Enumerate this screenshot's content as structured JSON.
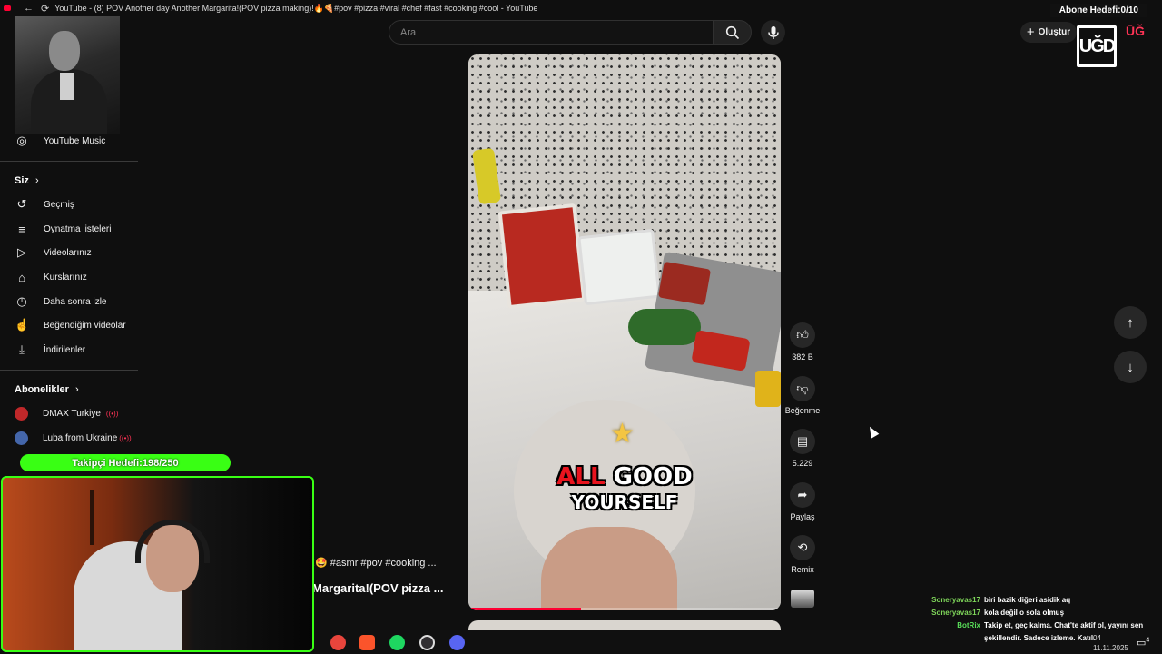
{
  "window": {
    "title": "YouTube - (8) POV Another day Another Margarita!(POV pizza making)!🔥🍕#pov #pizza #viral #chef #fast #cooking #cool - YouTube",
    "back_icon": "←",
    "reload_icon": "⟳"
  },
  "overlay": {
    "subscriber_goal": "Abone Hedefi:0/10",
    "follower_goal": "Takipçi Hedefi:198/250",
    "follower_progress": 0.792,
    "logo_text": "UĞD",
    "logo_small": "ŪĞ"
  },
  "header": {
    "search_placeholder": "Ara",
    "create_label": "Oluştur",
    "search_icon": "search-icon",
    "mic_icon": "mic-icon"
  },
  "sidebar": {
    "youtube_music": "YouTube Music",
    "you_heading": "Siz",
    "you_items": [
      {
        "label": "Geçmiş",
        "icon": "history-icon"
      },
      {
        "label": "Oynatma listeleri",
        "icon": "playlist-icon"
      },
      {
        "label": "Videolarınız",
        "icon": "your-videos-icon"
      },
      {
        "label": "Kurslarınız",
        "icon": "courses-icon"
      },
      {
        "label": "Daha sonra izle",
        "icon": "watch-later-icon"
      },
      {
        "label": "Beğendiğim videolar",
        "icon": "liked-icon"
      },
      {
        "label": "İndirilenler",
        "icon": "download-icon"
      }
    ],
    "subscriptions_heading": "Abonelikler",
    "subscriptions": [
      {
        "label": "DMAX Turkiye",
        "avatar_color": "#c0282a",
        "live": "((•))"
      },
      {
        "label": "Luba from Ukraine",
        "avatar_color": "#4466aa",
        "live": "((•))"
      }
    ]
  },
  "background_video": {
    "tags": "!🤩 #asmr #pov #cooking ...",
    "title": "Margarita!(POV pizza ..."
  },
  "video": {
    "caption_word1": "ALL",
    "caption_word2": "GOOD",
    "caption_line2": "YOURSELF",
    "progress": 0.36
  },
  "actions": {
    "like_count": "382 B",
    "dislike_label": "Beğenme",
    "comment_count": "5.229",
    "share_label": "Paylaş",
    "remix_label": "Remix"
  },
  "chat": [
    {
      "user": "Soneryavas17",
      "message": "biri bazik diğeri asidik aq",
      "color": "#7fd65a"
    },
    {
      "user": "Soneryavas17",
      "message": "kola değil o sola olmuş",
      "color": "#7fd65a"
    },
    {
      "user": "BotRix",
      "message": "Takip et, geç kalma. Chat'te aktif ol, yayını sen şekillendir. Sadece izleme. Katıl.",
      "color": "#5ae05a"
    }
  ],
  "taskbar": {
    "time": "04",
    "date": "11.11.2025",
    "notification_count": "4",
    "apps": [
      {
        "name": "chrome-icon",
        "color": "#e8453c"
      },
      {
        "name": "brave-icon",
        "color": "#fb542b"
      },
      {
        "name": "spotify-icon",
        "color": "#1ed760"
      },
      {
        "name": "obs-icon",
        "color": "#302e31"
      },
      {
        "name": "discord-icon",
        "color": "#5865f2"
      }
    ]
  }
}
